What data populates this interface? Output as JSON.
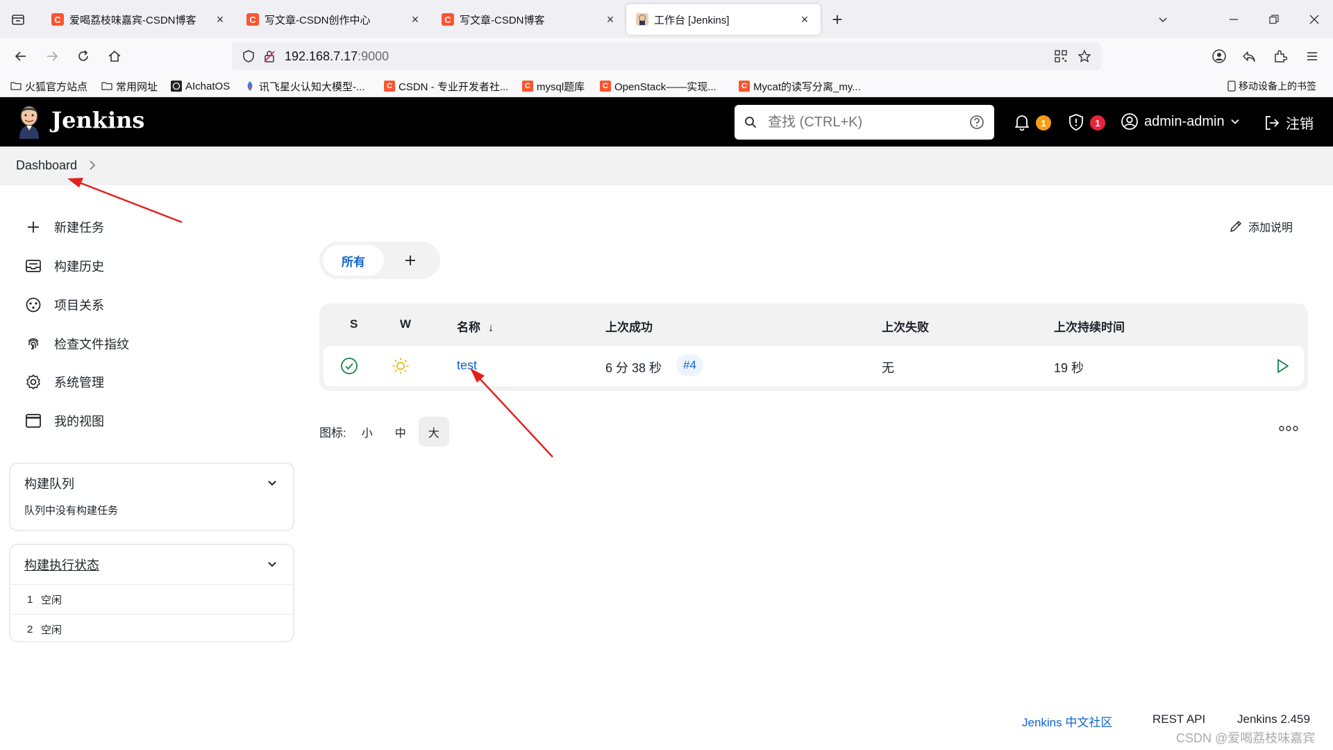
{
  "browser": {
    "tabs": [
      {
        "title": "爱喝荔枝味嘉宾-CSDN博客",
        "favicon": "C"
      },
      {
        "title": "写文章-CSDN创作中心",
        "favicon": "C"
      },
      {
        "title": "写文章-CSDN博客",
        "favicon": "C"
      },
      {
        "title": "工作台 [Jenkins]",
        "favicon": "jenkins-icon"
      }
    ],
    "url_host": "192.168.7.17",
    "url_port": ":9000",
    "bookmarks": [
      {
        "label": "火狐官方站点",
        "icon": "folder-icon"
      },
      {
        "label": "常用网址",
        "icon": "folder-icon"
      },
      {
        "label": "AIchatOS",
        "icon": "openai-icon"
      },
      {
        "label": "讯飞星火认知大模型-...",
        "icon": "spark-icon"
      },
      {
        "label": "CSDN - 专业开发者社...",
        "icon": "C"
      },
      {
        "label": "mysql题库",
        "icon": "C"
      },
      {
        "label": "OpenStack——实现...",
        "icon": "C"
      },
      {
        "label": "Mycat的读写分离_my...",
        "icon": "C"
      }
    ],
    "mobile_bookmarks": "移动设备上的书签"
  },
  "header": {
    "brand": "Jenkins",
    "search_placeholder": "查找 (CTRL+K)",
    "notifications_count": "1",
    "security_count": "1",
    "user": "admin-admin",
    "logout": "注销",
    "colors": {
      "notif_badge": "#f59c1a",
      "security_badge": "#e5243b"
    }
  },
  "breadcrumb": {
    "dashboard": "Dashboard"
  },
  "sidebar": {
    "items": [
      {
        "label": "新建任务",
        "icon": "plus-icon"
      },
      {
        "label": "构建历史",
        "icon": "inbox-icon"
      },
      {
        "label": "项目关系",
        "icon": "relationship-icon"
      },
      {
        "label": "检查文件指纹",
        "icon": "fingerprint-icon"
      },
      {
        "label": "系统管理",
        "icon": "gear-icon"
      },
      {
        "label": "我的视图",
        "icon": "window-icon"
      }
    ],
    "build_queue": {
      "title": "构建队列",
      "empty": "队列中没有构建任务"
    },
    "executors": {
      "title": "构建执行状态",
      "rows": [
        {
          "num": "1",
          "status": "空闲"
        },
        {
          "num": "2",
          "status": "空闲"
        }
      ]
    }
  },
  "main": {
    "add_description": "添加说明",
    "view_tab_all": "所有",
    "table": {
      "headers": {
        "s": "S",
        "w": "W",
        "name": "名称",
        "sort": "↓",
        "last_success": "上次成功",
        "last_failure": "上次失败",
        "last_duration": "上次持续时间"
      },
      "rows": [
        {
          "name": "test",
          "last_success": "6 分 38 秒",
          "build": "#4",
          "last_failure": "无",
          "last_duration": "19 秒",
          "status": "success",
          "weather": "sunny"
        }
      ]
    },
    "icon_size_label": "图标:",
    "icon_sizes": [
      "小",
      "中",
      "大"
    ],
    "icon_size_selected": "大"
  },
  "footer": {
    "community": "Jenkins 中文社区",
    "rest_api": "REST API",
    "version": "Jenkins 2.459"
  },
  "watermark": "CSDN @爱喝荔枝味嘉宾"
}
